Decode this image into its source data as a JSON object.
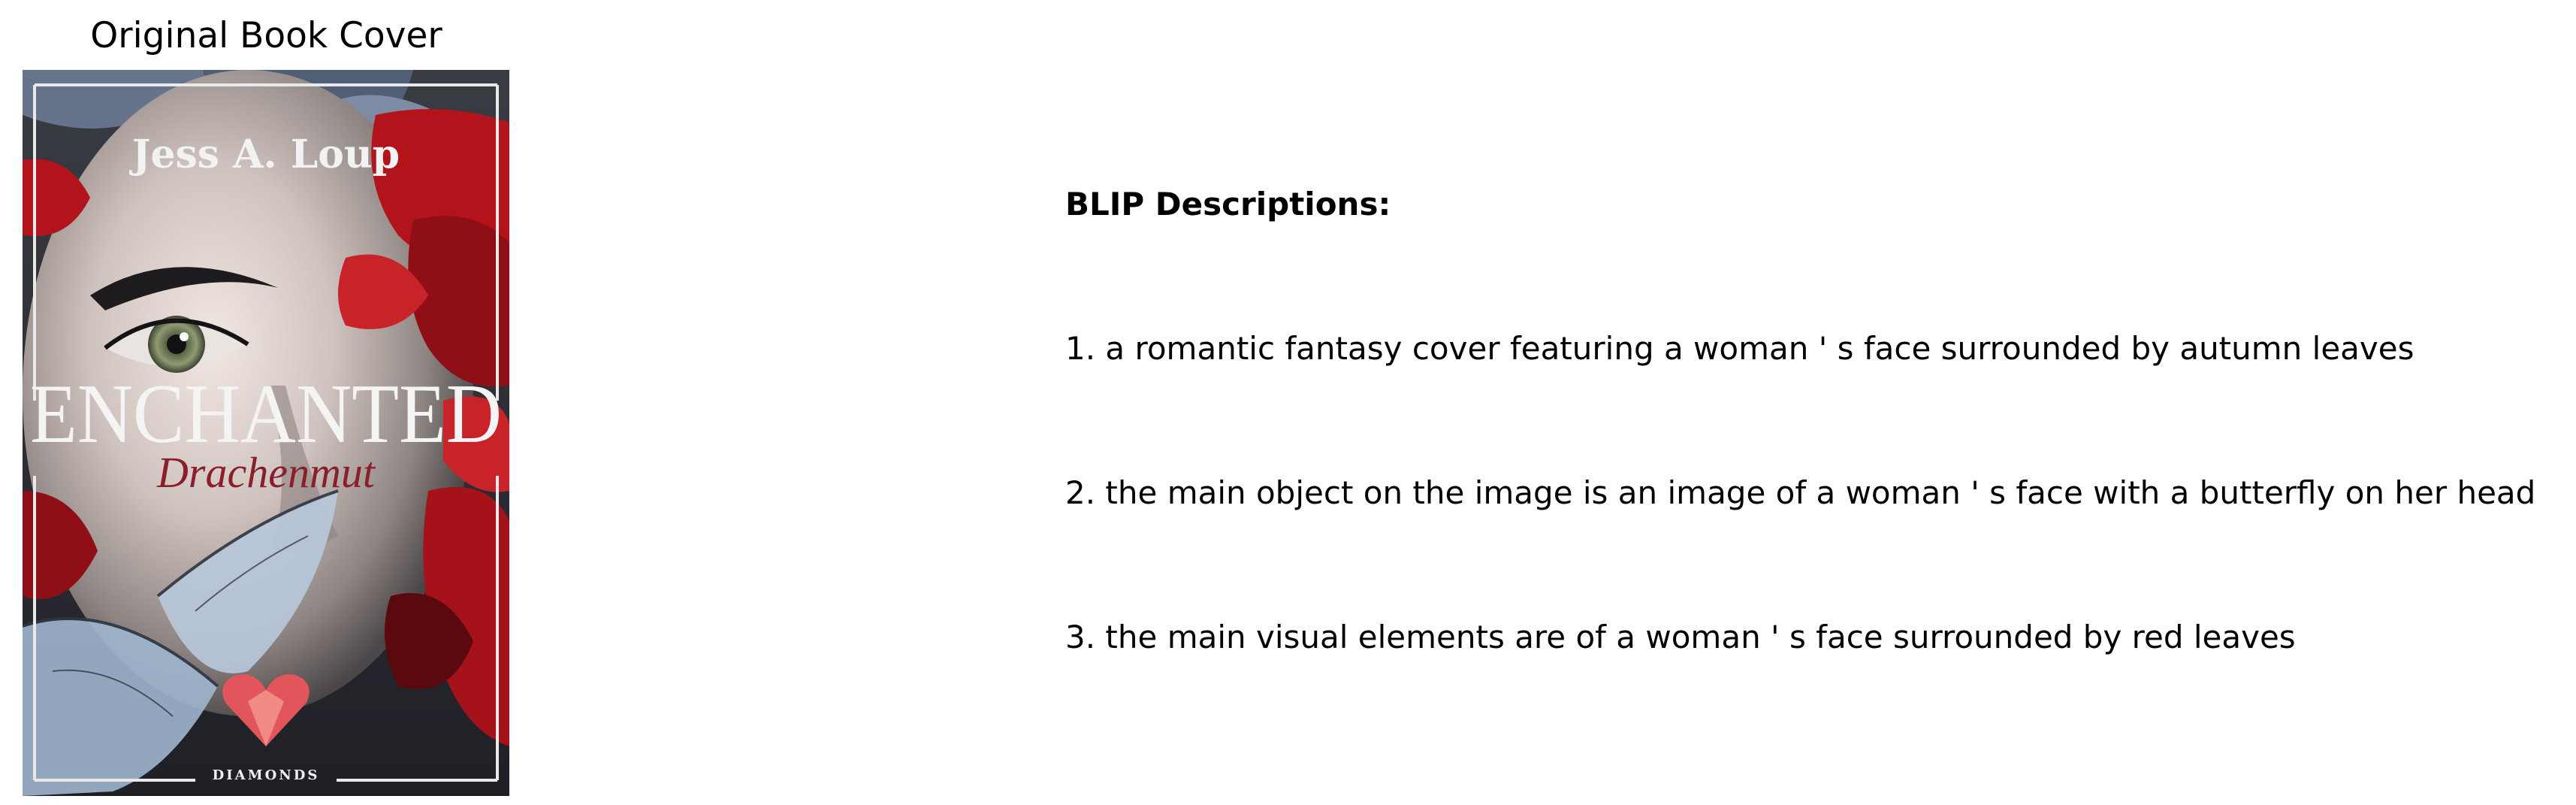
{
  "left_panel": {
    "title": "Original Book Cover",
    "cover": {
      "author": "Jess A. Loup",
      "title": "ENCHANTED",
      "subtitle": "Drachenmut",
      "publisher": "DIAMONDS"
    }
  },
  "right_panel": {
    "heading": "BLIP Descriptions:",
    "descriptions": [
      "1. a romantic fantasy cover featuring a woman ' s face surrounded by autumn leaves",
      "2. the main object on the image is an image of a woman ' s face with a butterfly on her head",
      "3. the main visual elements are of a woman ' s face surrounded by red leaves"
    ]
  },
  "colors": {
    "leaf_red": "#b3141c",
    "leaf_dark": "#5a0a0e",
    "cover_bg": "#2c2f38",
    "wing_blue": "#9fb6cf",
    "frame": "#e9e9ea",
    "subtitle": "#8a1f2c"
  }
}
